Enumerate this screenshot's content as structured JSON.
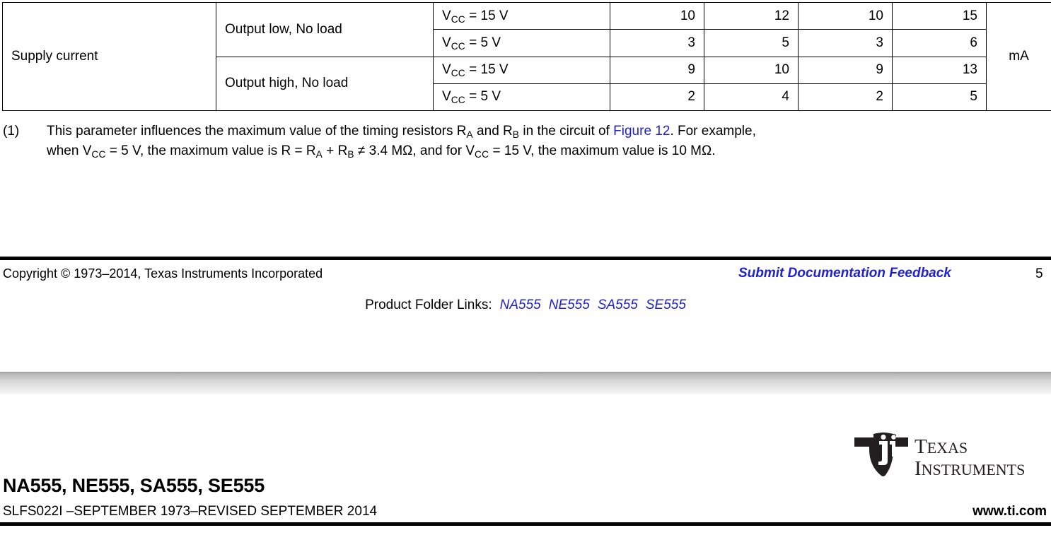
{
  "table": {
    "parameter": "Supply current",
    "unit": "mA",
    "rows": [
      {
        "condition": "Output low, No load",
        "vcc_prefix": "V",
        "vcc_sub": "CC",
        "vcc_suffix": " = 15 V",
        "col1": "10",
        "col2": "12",
        "col3": "10",
        "col4": "15"
      },
      {
        "condition": "Output low, No load",
        "vcc_prefix": "V",
        "vcc_sub": "CC",
        "vcc_suffix": " = 5 V",
        "col1": "3",
        "col2": "5",
        "col3": "3",
        "col4": "6"
      },
      {
        "condition": "Output high, No load",
        "vcc_prefix": "V",
        "vcc_sub": "CC",
        "vcc_suffix": " = 15 V",
        "col1": "9",
        "col2": "10",
        "col3": "9",
        "col4": "13"
      },
      {
        "condition": "Output high, No load",
        "vcc_prefix": "V",
        "vcc_sub": "CC",
        "vcc_suffix": " = 5 V",
        "col1": "2",
        "col2": "4",
        "col3": "2",
        "col4": "5"
      }
    ]
  },
  "footnote": {
    "marker": "(1)",
    "line1_a": "This parameter influences the maximum value of the timing resistors R",
    "line1_sub1": "A",
    "line1_b": " and R",
    "line1_sub2": "B",
    "line1_c": " in the circuit of ",
    "line1_link": "Figure 12",
    "line1_d": ". For example,",
    "line2_a": "when V",
    "line2_sub1": "CC",
    "line2_b": " = 5 V, the maximum value is R = R",
    "line2_sub2": "A",
    "line2_c": " + R",
    "line2_sub3": "B",
    "line2_d": "  ≠ 3.4 MΩ, and for V",
    "line2_sub4": "CC",
    "line2_e": " = 15 V, the maximum value is 10 MΩ."
  },
  "footer": {
    "copyright": "Copyright © 1973–2014, Texas Instruments Incorporated",
    "feedback_link": "Submit Documentation Feedback",
    "page_number": "5",
    "product_links_label": "Product Folder Links:",
    "product_links": [
      "NA555",
      "NE555",
      "SA555",
      "SE555"
    ]
  },
  "header": {
    "part_title": "NA555, NE555, SA555, SE555",
    "doc_id": "SLFS022I –SEPTEMBER 1973–REVISED SEPTEMBER 2014",
    "ti_url": "www.ti.com",
    "logo_line1": "Texas",
    "logo_line2": "Instruments"
  },
  "colors": {
    "link_blue": "#2222cc",
    "text_black": "#000000",
    "page_gap_gray": "#d6d6d6"
  }
}
